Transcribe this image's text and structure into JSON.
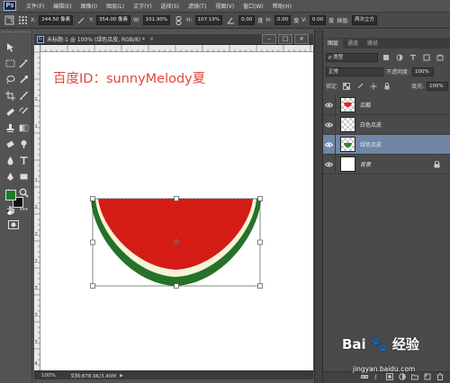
{
  "app": {
    "logo": "Ps"
  },
  "menu": [
    "文件(F)",
    "编辑(E)",
    "图像(I)",
    "图层(L)",
    "文字(Y)",
    "选择(S)",
    "滤镜(T)",
    "视图(V)",
    "窗口(W)",
    "帮助(H)"
  ],
  "options": {
    "x_label": "X:",
    "x_value": "244.50 像素",
    "y_label": "Y:",
    "y_value": "354.00 像素",
    "w_label": "W:",
    "w_value": "101.90%",
    "h_label": "H:",
    "h_value": "107.19%",
    "angle_value": "0.00",
    "angle_unit": "度",
    "hskew_label": "H:",
    "hskew_value": "0.00",
    "vskew_label": "V:",
    "vskew_value": "0.00",
    "unit_degree": "度",
    "interp_label": "插值:",
    "interp_value": "两次立方"
  },
  "document": {
    "title": "未标题-1 @ 100% (绿色瓜皮, RGB/8) *",
    "close": "×",
    "minimize": "–",
    "maximize": "□",
    "close_window": "×",
    "zoom": "100%",
    "doc_size": "文档:878.9K/3.40M",
    "status_arrow": "▶",
    "canvas_text": "百度ID：sunnyMelody夏"
  },
  "ruler_left_digits": [
    "1",
    "1",
    "1",
    "2",
    "2",
    "2",
    "3",
    "3",
    "3",
    "4"
  ],
  "panel": {
    "tabs": [
      "图层",
      "通道",
      "路径"
    ],
    "kind_label": "ρ 类型",
    "blend_mode": "正常",
    "opacity_label": "不透明度:",
    "opacity_value": "100%",
    "lock_label": "锁定:",
    "fill_label": "填充:",
    "fill_value": "100%",
    "layers": [
      {
        "name": "瓜瓤",
        "selected": false,
        "thumb": "checker-red"
      },
      {
        "name": "白色瓜皮",
        "selected": false,
        "thumb": "checker"
      },
      {
        "name": "绿色瓜皮",
        "selected": true,
        "thumb": "checker-green"
      },
      {
        "name": "背景",
        "selected": false,
        "thumb": "white"
      }
    ]
  },
  "colors": {
    "foreground": "#1f7a2a",
    "background": "#111111",
    "flesh": "#e8221f",
    "white_rind": "#f7f3d6",
    "green_rind": "#2f7d32",
    "canvas_text": "#e0483b",
    "selected_layer": "#6f86a6"
  },
  "watermark": {
    "logo": "Bai 🐾 经验",
    "url": "jingyan.baidu.com"
  }
}
